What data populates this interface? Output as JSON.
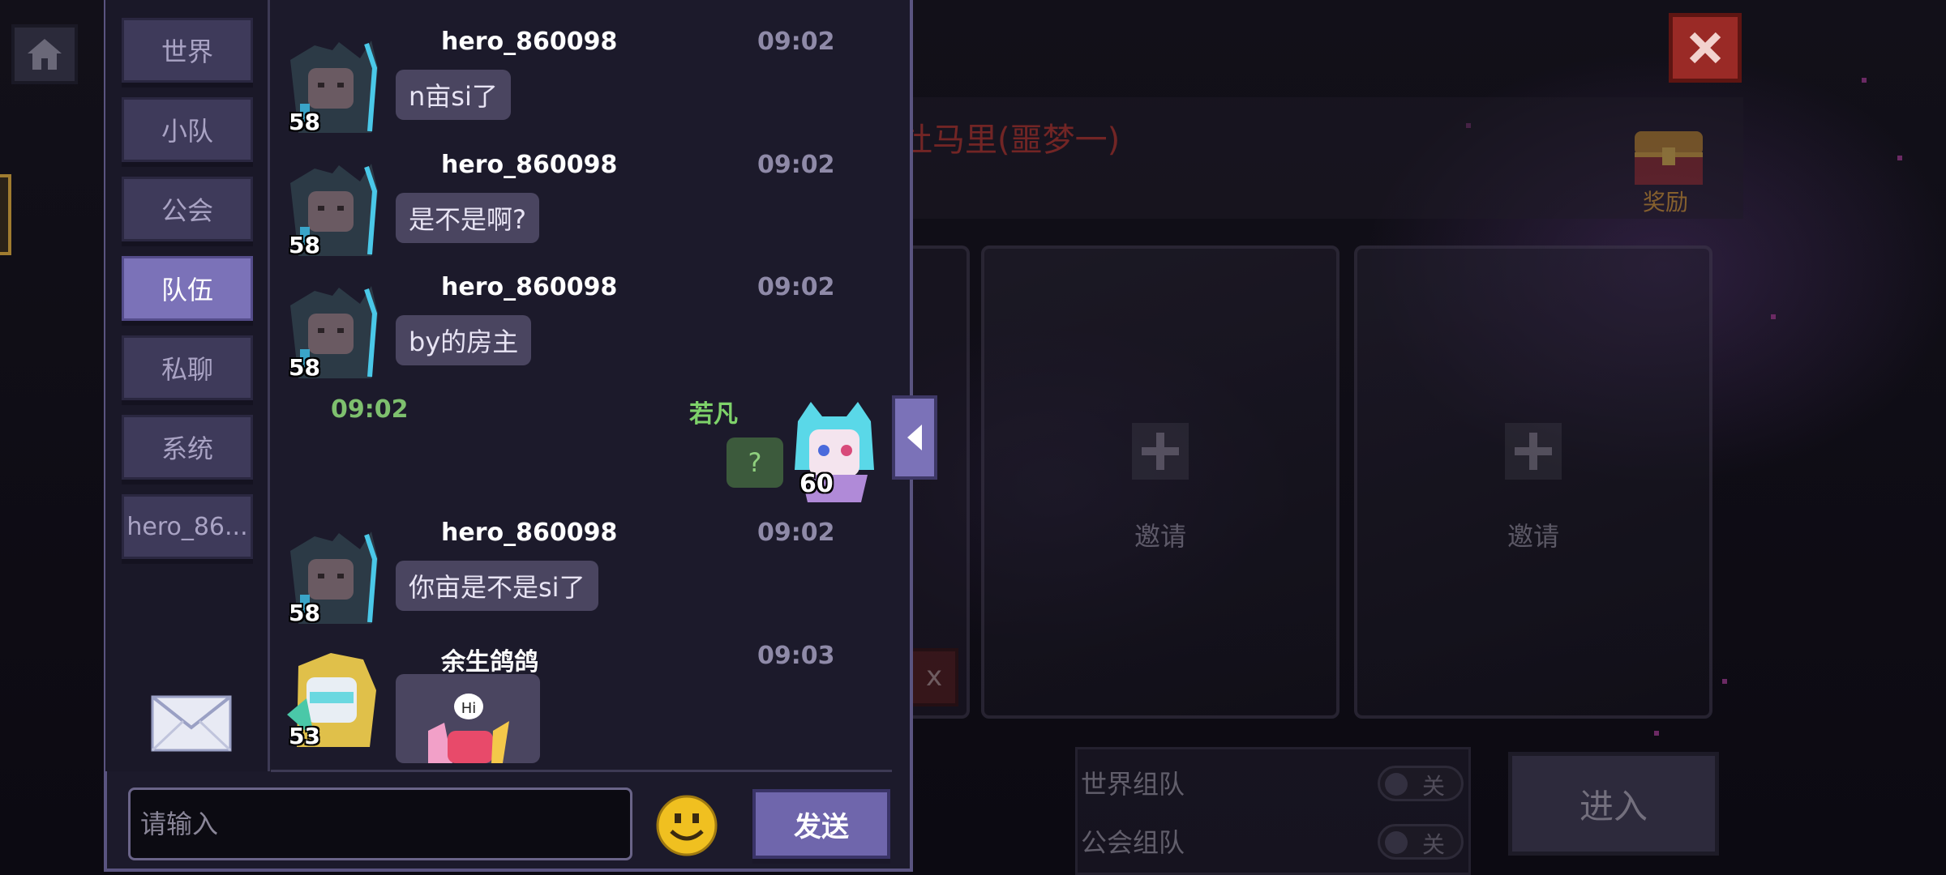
{
  "background_panel": {
    "stage_title": "杜马里(噩梦一)",
    "reward_label": "奖励",
    "invite_slots": [
      {
        "label": "邀请"
      },
      {
        "label": "邀请"
      }
    ],
    "toggles": [
      {
        "label": "世界组队",
        "state": "关"
      },
      {
        "label": "公会组队",
        "state": "关"
      }
    ],
    "enter_label": "进入"
  },
  "chat": {
    "tabs": [
      {
        "label": "世界",
        "active": false
      },
      {
        "label": "小队",
        "active": false
      },
      {
        "label": "公会",
        "active": false
      },
      {
        "label": "队伍",
        "active": true
      },
      {
        "label": "私聊",
        "active": false
      },
      {
        "label": "系统",
        "active": false
      },
      {
        "label": "hero_86...",
        "active": false
      }
    ],
    "messages": [
      {
        "username": "hero_860098",
        "time": "09:02",
        "level": "58",
        "text": "n亩si了"
      },
      {
        "username": "hero_860098",
        "time": "09:02",
        "level": "58",
        "text": "是不是啊?"
      },
      {
        "username": "hero_860098",
        "time": "09:02",
        "level": "58",
        "text": "by的房主"
      },
      {
        "username": "hero_860098",
        "time": "09:02",
        "level": "58",
        "text": "你亩是不是si了"
      },
      {
        "username": "余生鸽鸽",
        "time": "09:03",
        "level": "53",
        "sticker_text": "Hi"
      }
    ],
    "standalone_time": "09:02",
    "self_message": {
      "username": "若凡",
      "level": "60",
      "text": "?"
    },
    "input": {
      "placeholder": "请输入",
      "value": ""
    },
    "send_label": "发送"
  },
  "icons": {
    "home": "home-icon",
    "close": "close-icon",
    "mail": "mail-icon",
    "emoji": "smiley-icon",
    "collapse": "chevron-left-icon",
    "reward": "treasure-chest-icon"
  },
  "colors": {
    "active_tab": "#7b72b8",
    "tab": "#3e3a5a",
    "bubble": "#4a4560",
    "self_name": "#7ed26a",
    "close_button": "#9a2a26",
    "stage_title": "#c43a32"
  }
}
